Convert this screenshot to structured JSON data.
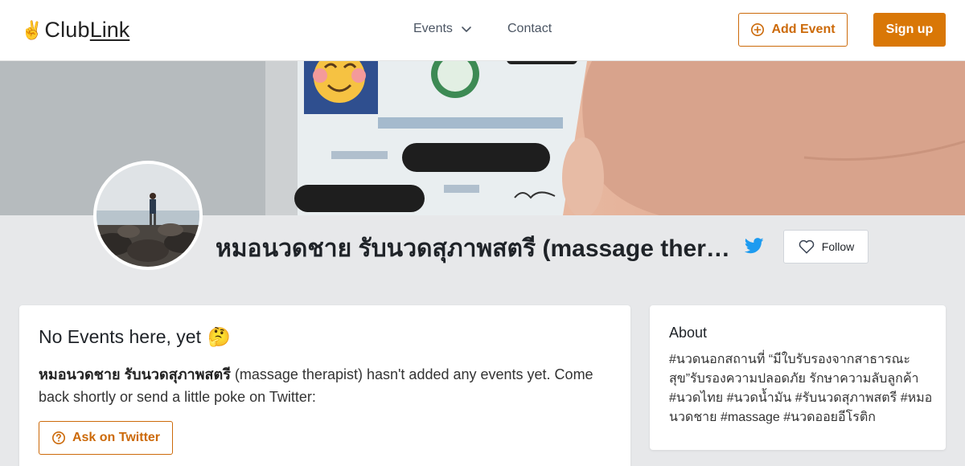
{
  "header": {
    "logo_emoji": "✌️",
    "logo_club": "Club",
    "logo_link": "Link",
    "nav": {
      "events_label": "Events",
      "contact_label": "Contact"
    },
    "add_event_label": "Add Event",
    "signup_label": "Sign up"
  },
  "profile": {
    "name": "หมอนวดชาย รับนวดสุภาพสตรี (massage therapist)",
    "follow_label": "Follow"
  },
  "events": {
    "title": "No Events here, yet",
    "title_emoji": "🤔",
    "desc_name": "หมอนวดชาย รับนวดสุภาพสตรี",
    "desc_rest": " (massage therapist) hasn't added any events yet. Come back shortly or send a little poke on Twitter:",
    "ask_label": "Ask on Twitter"
  },
  "about": {
    "title": "About",
    "text": "#นวดนอกสถานที่ “มีใบรับรองจากสาธารณะสุข”รับรองความปลอดภัย รักษาความลับลูกค้า #นวดไทย #นวดน้ำมัน #รับนวดสุภาพสตรี #หมอนวดชาย #massage #นวดออยอีโรติก"
  },
  "colors": {
    "accent": "#d97706",
    "accent_dark": "#cc6a0a",
    "twitter": "#1d9bf0"
  },
  "icons": [
    "chevron-down-icon",
    "plus-circle-icon",
    "twitter-icon",
    "heart-icon",
    "help-circle-icon"
  ]
}
